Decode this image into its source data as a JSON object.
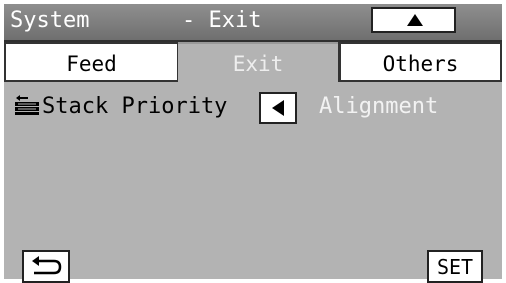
{
  "title": {
    "menu": "System",
    "section": "- Exit"
  },
  "scroll_up_icon": "up-triangle-icon",
  "tabs": [
    {
      "label": "Feed",
      "active": false
    },
    {
      "label": "Exit",
      "active": true
    },
    {
      "label": "Others",
      "active": false
    }
  ],
  "setting": {
    "icon": "stack-priority-icon",
    "label": "Stack Priority",
    "prev_icon": "left-triangle-icon",
    "value": "Alignment"
  },
  "footer": {
    "back_icon": "return-arrow-icon",
    "set_label": "SET"
  },
  "colors": {
    "panel": "#b3b3b3",
    "title_bar": "#7f7f7f",
    "selected_value_text": "#f2f2f2"
  }
}
